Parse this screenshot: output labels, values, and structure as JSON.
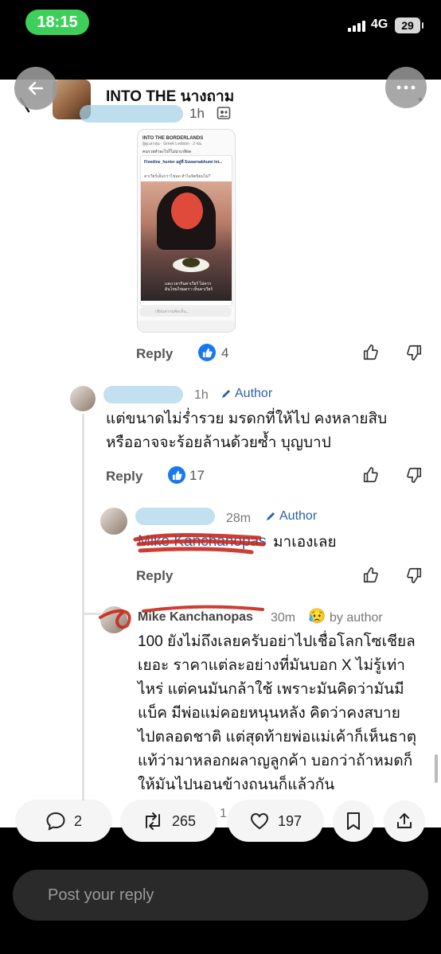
{
  "status_bar": {
    "time": "18:15",
    "network": "4G",
    "battery": "29"
  },
  "header": {
    "group_title": "INTO THE นางถาม",
    "time": "1h"
  },
  "embedded_post": {
    "title": "INTO THE BORDERLANDS",
    "subtitle": "ผู้ดูแลกลุ่ม · Greek Lesbian · 2 ชม.",
    "question": "คนรวยทำอะไรก็ไม่น่าเกลียด",
    "commenter": "Finedine_hunter อยู่ที่ Suwarnabhumi Int...",
    "comment_line": "คาเวียร์เค็มกว่าไข่มด ทำไมจิตนิยมไม่?",
    "caption": "และเวลากินคาเวียร์ ไม่ควร ด้นโทษไข่มดรา เห็นคาเวียร์",
    "reply_placeholder": "เขียนความคิดเห็น..."
  },
  "comments": [
    {
      "reply_label": "Reply",
      "likes": "4"
    },
    {
      "time": "1h",
      "author_label": "Author",
      "text_line1": "แต่ขนาดไม่ร่ำรวย มรดกที่ให้ไป คงหลายสิบ",
      "text_line2": "หรืออาจจะร้อยล้านด้วยซ้ำ บุญบาป",
      "reply_label": "Reply",
      "likes": "17"
    },
    {
      "time": "28m",
      "author_label": "Author",
      "mention": "Mike Kanchanopas",
      "text": "มาเองเลย",
      "reply_label": "Reply"
    },
    {
      "name": "Mike Kanchanopas",
      "time": "30m",
      "emoji": "😥",
      "by_author": "by author",
      "lines": [
        "100 ยังไม่ถึงเลยครับอย่าไปเชื่อโลกโซเชียล",
        "เยอะ ราคาแต่ละอย่างที่มันบอก X ไม่รู้เท่า",
        "ไหร่ แต่คนมันกล้าใช้ เพราะมันคิดว่ามันมี",
        "แบ็ค มีพ่อแม่คอยหนุนหลัง คิดว่าคงสบาย",
        "ไปตลอดชาติ แต่สุดท้ายพ่อแม่เค้าก็เห็นธาตุ",
        "แท้ว่ามาหลอกผลาญลูกค้า บอกว่าถ้าหมดก็",
        "ให้มันไปนอนข้างถนนก็แล้วกัน"
      ]
    }
  ],
  "actions": {
    "replies": "2",
    "reposts": "265",
    "likes": "197",
    "partial_count": "1"
  },
  "reply_bar": {
    "placeholder": "Post your reply"
  }
}
